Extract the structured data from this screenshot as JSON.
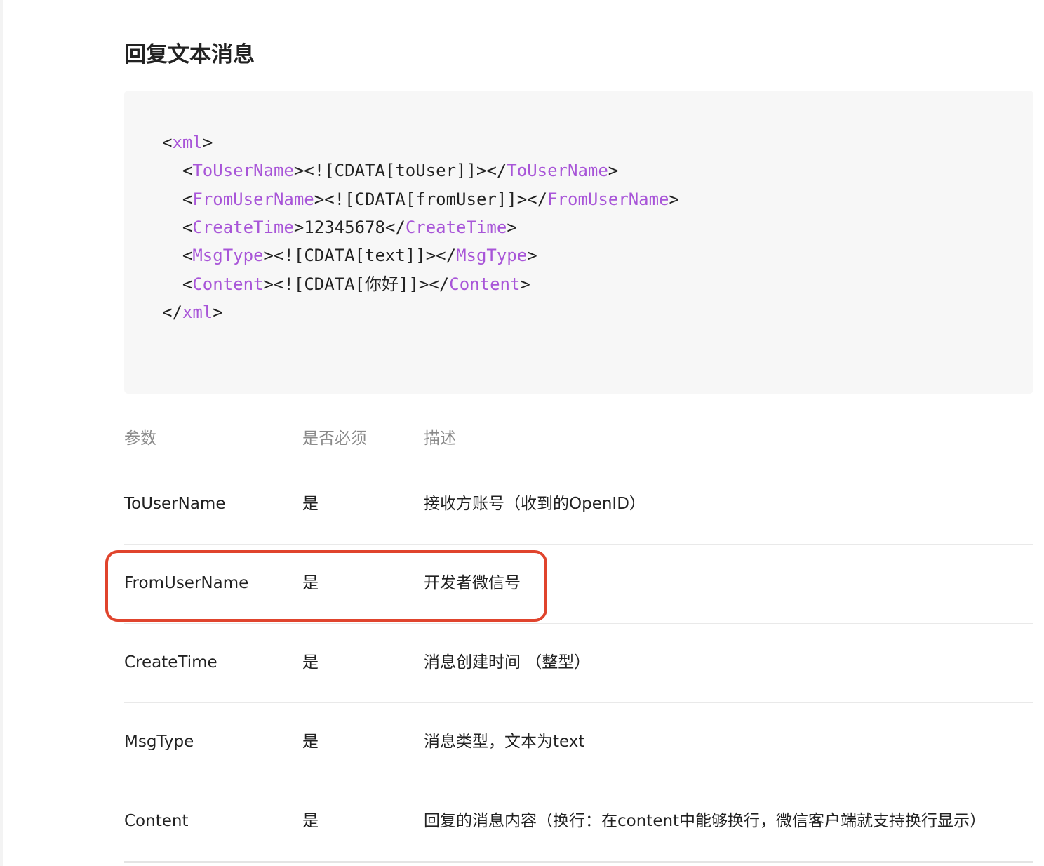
{
  "page": {
    "title": "回复文本消息"
  },
  "code": {
    "lines": [
      [
        {
          "t": "p",
          "v": "<"
        },
        {
          "t": "k",
          "v": "xml"
        },
        {
          "t": "p",
          "v": ">"
        }
      ],
      [
        {
          "t": "p",
          "v": "  <"
        },
        {
          "t": "k",
          "v": "ToUserName"
        },
        {
          "t": "p",
          "v": "><![CDATA[toUser]]></"
        },
        {
          "t": "k",
          "v": "ToUserName"
        },
        {
          "t": "p",
          "v": ">"
        }
      ],
      [
        {
          "t": "p",
          "v": "  <"
        },
        {
          "t": "k",
          "v": "FromUserName"
        },
        {
          "t": "p",
          "v": "><![CDATA[fromUser]]></"
        },
        {
          "t": "k",
          "v": "FromUserName"
        },
        {
          "t": "p",
          "v": ">"
        }
      ],
      [
        {
          "t": "p",
          "v": "  <"
        },
        {
          "t": "k",
          "v": "CreateTime"
        },
        {
          "t": "p",
          "v": ">12345678</"
        },
        {
          "t": "k",
          "v": "CreateTime"
        },
        {
          "t": "p",
          "v": ">"
        }
      ],
      [
        {
          "t": "p",
          "v": "  <"
        },
        {
          "t": "k",
          "v": "MsgType"
        },
        {
          "t": "p",
          "v": "><![CDATA[text]]></"
        },
        {
          "t": "k",
          "v": "MsgType"
        },
        {
          "t": "p",
          "v": ">"
        }
      ],
      [
        {
          "t": "p",
          "v": "  <"
        },
        {
          "t": "k",
          "v": "Content"
        },
        {
          "t": "p",
          "v": "><![CDATA[你好]]></"
        },
        {
          "t": "k",
          "v": "Content"
        },
        {
          "t": "p",
          "v": ">"
        }
      ],
      [
        {
          "t": "p",
          "v": "</"
        },
        {
          "t": "k",
          "v": "xml"
        },
        {
          "t": "p",
          "v": ">"
        }
      ]
    ]
  },
  "table": {
    "headers": [
      "参数",
      "是否必须",
      "描述"
    ],
    "rows": [
      [
        "ToUserName",
        "是",
        "接收方账号（收到的OpenID）"
      ],
      [
        "FromUserName",
        "是",
        "开发者微信号"
      ],
      [
        "CreateTime",
        "是",
        "消息创建时间 （整型）"
      ],
      [
        "MsgType",
        "是",
        "消息类型，文本为text"
      ],
      [
        "Content",
        "是",
        "回复的消息内容（换行：在content中能够换行，微信客户端就支持换行显示）"
      ]
    ]
  },
  "colors": {
    "tag": "#a855d8",
    "highlight": "#e0442d",
    "code_bg": "#f7f7f7"
  }
}
